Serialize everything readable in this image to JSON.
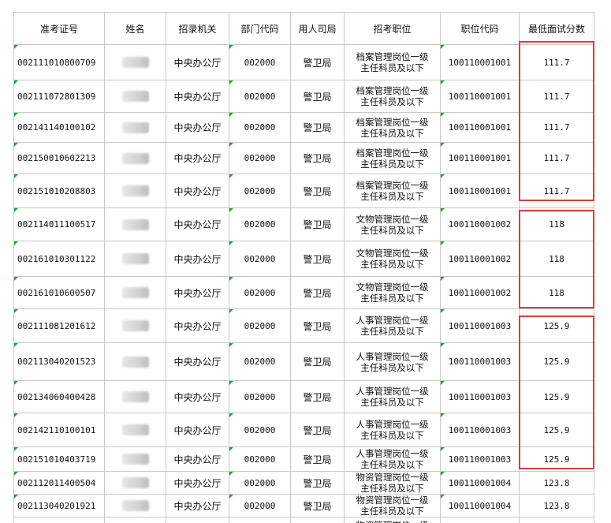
{
  "headers": [
    "准考证号",
    "姓名",
    "招录机关",
    "部门代码",
    "用人司局",
    "招考职位",
    "职位代码",
    "最低面试分数"
  ],
  "rows": [
    {
      "id": "002111010800709",
      "org": "中央办公厅",
      "dept": "002000",
      "bureau": "警卫局",
      "pos1": "档案管理岗位一级",
      "pos2": "主任科员及以下",
      "code": "100110001001",
      "score": "111.7"
    },
    {
      "id": "002111072801309",
      "org": "中央办公厅",
      "dept": "002000",
      "bureau": "警卫局",
      "pos1": "档案管理岗位一级",
      "pos2": "主任科员及以下",
      "code": "100110001001",
      "score": "111.7"
    },
    {
      "id": "002141140100102",
      "org": "中央办公厅",
      "dept": "002000",
      "bureau": "警卫局",
      "pos1": "档案管理岗位一级",
      "pos2": "主任科员及以下",
      "code": "100110001001",
      "score": "111.7"
    },
    {
      "id": "002150010602213",
      "org": "中央办公厅",
      "dept": "002000",
      "bureau": "警卫局",
      "pos1": "档案管理岗位一级",
      "pos2": "主任科员及以下",
      "code": "100110001001",
      "score": "111.7"
    },
    {
      "id": "002151010208803",
      "org": "中央办公厅",
      "dept": "002000",
      "bureau": "警卫局",
      "pos1": "档案管理岗位一级",
      "pos2": "主任科员及以下",
      "code": "100110001001",
      "score": "111.7"
    },
    {
      "id": "002114011100517",
      "org": "中央办公厅",
      "dept": "002000",
      "bureau": "警卫局",
      "pos1": "文物管理岗位一级",
      "pos2": "主任科员及以下",
      "code": "100110001002",
      "score": "118"
    },
    {
      "id": "002161010301122",
      "org": "中央办公厅",
      "dept": "002000",
      "bureau": "警卫局",
      "pos1": "文物管理岗位一级",
      "pos2": "主任科员及以下",
      "code": "100110001002",
      "score": "118"
    },
    {
      "id": "002161010600507",
      "org": "中央办公厅",
      "dept": "002000",
      "bureau": "警卫局",
      "pos1": "文物管理岗位一级",
      "pos2": "主任科员及以下",
      "code": "100110001002",
      "score": "118"
    },
    {
      "id": "002111081201612",
      "org": "中央办公厅",
      "dept": "002000",
      "bureau": "警卫局",
      "pos1": "人事管理岗位一级",
      "pos2": "主任科员及以下",
      "code": "100110001003",
      "score": "125.9"
    },
    {
      "id": "002113040201523",
      "org": "中央办公厅",
      "dept": "002000",
      "bureau": "警卫局",
      "pos1": "人事管理岗位一级",
      "pos2": "主任科员及以下",
      "code": "100110001003",
      "score": "125.9"
    },
    {
      "id": "002134060400428",
      "org": "中央办公厅",
      "dept": "002000",
      "bureau": "警卫局",
      "pos1": "人事管理岗位一级",
      "pos2": "主任科员及以下",
      "code": "100110001003",
      "score": "125.9"
    },
    {
      "id": "002142110100101",
      "org": "中央办公厅",
      "dept": "002000",
      "bureau": "警卫局",
      "pos1": "人事管理岗位一级",
      "pos2": "主任科员及以下",
      "code": "100110001003",
      "score": "125.9"
    },
    {
      "id": "002151010403719",
      "org": "中央办公厅",
      "dept": "002000",
      "bureau": "警卫局",
      "pos1": "人事管理岗位一级",
      "pos2": "主任科员及以下",
      "code": "100110001003",
      "score": "125.9"
    },
    {
      "id": "002112011400504",
      "org": "中央办公厅",
      "dept": "002000",
      "bureau": "警卫局",
      "pos1": "物资管理岗位一级",
      "pos2": "主任科员及以下",
      "code": "100110001004",
      "score": "123.8"
    },
    {
      "id": "002113040201921",
      "org": "中央办公厅",
      "dept": "002000",
      "bureau": "警卫局",
      "pos1": "物资管理岗位一级",
      "pos2": "主任科员及以下",
      "code": "100110001004",
      "score": "123.8"
    },
    {
      "id": "",
      "org": "",
      "dept": "",
      "bureau": "",
      "pos1": "物资管理岗位一级",
      "pos2": "",
      "code": "",
      "score": ""
    }
  ],
  "highlight_color": "#e03b3b",
  "cell_marker_color": "#2e9b3b"
}
